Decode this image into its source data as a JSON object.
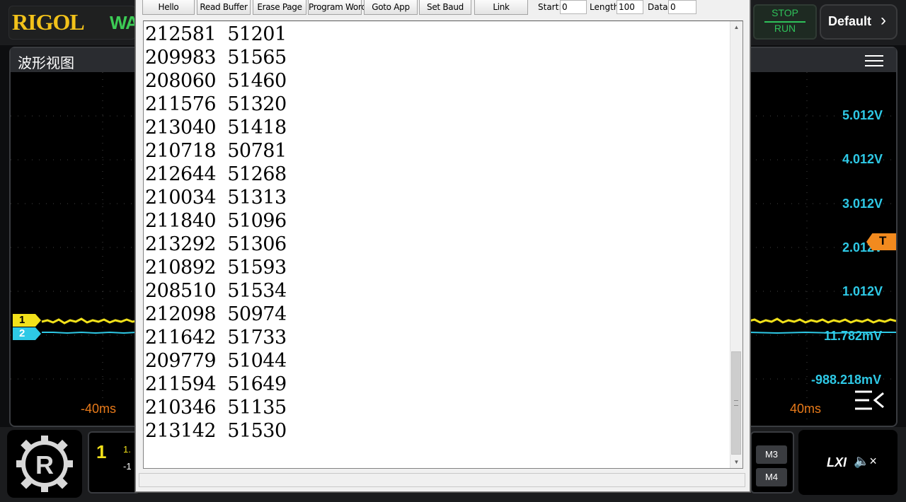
{
  "scope": {
    "brand": "RIGOL",
    "brand_suffix": "WA",
    "panel_title": "波形视图",
    "stop_label": "STOP",
    "run_label": "RUN",
    "default_label": "Default",
    "volt_labels": [
      "5.012V",
      "4.012V",
      "3.012V",
      "2.012V",
      "1.012V",
      "11.782mV",
      "-988.218mV"
    ],
    "time_left": "-40ms",
    "time_right": "40ms",
    "trigger_label": "T",
    "ch1_tag": "1",
    "ch2_tag": "2",
    "ch1_number": "1",
    "ch1_partial_a": "1.",
    "ch1_partial_b": "-1",
    "m3_label": "M3",
    "m4_label": "M4",
    "lxi_label": "LXI",
    "colors": {
      "ch1": "#f2e11a",
      "ch2": "#2ec9e6",
      "trigger": "#f28a1e",
      "run": "#2fc15a"
    }
  },
  "app": {
    "toolbar": {
      "hello": "Hello",
      "read_buffer": "Read Buffer",
      "erase_page": "Erase Page",
      "program_word": "Program Word",
      "goto_app": "Goto App",
      "set_baud": "Set Baud",
      "link": "Link",
      "start_label": "Start:",
      "start_value": "0",
      "length_label": "Length:",
      "length_value": "100",
      "data_label": "Data:",
      "data_value": "0"
    },
    "rows": [
      "212581  51201",
      "209983  51565",
      "208060  51460",
      "211576  51320",
      "213040  51418",
      "210718  50781",
      "212644  51268",
      "210034  51313",
      "211840  51096",
      "213292  51306",
      "210892  51593",
      "208510  51534",
      "212098  50974",
      "211642  51733",
      "209779  51044",
      "211594  51649",
      "210346  51135",
      "213142  51530"
    ]
  }
}
